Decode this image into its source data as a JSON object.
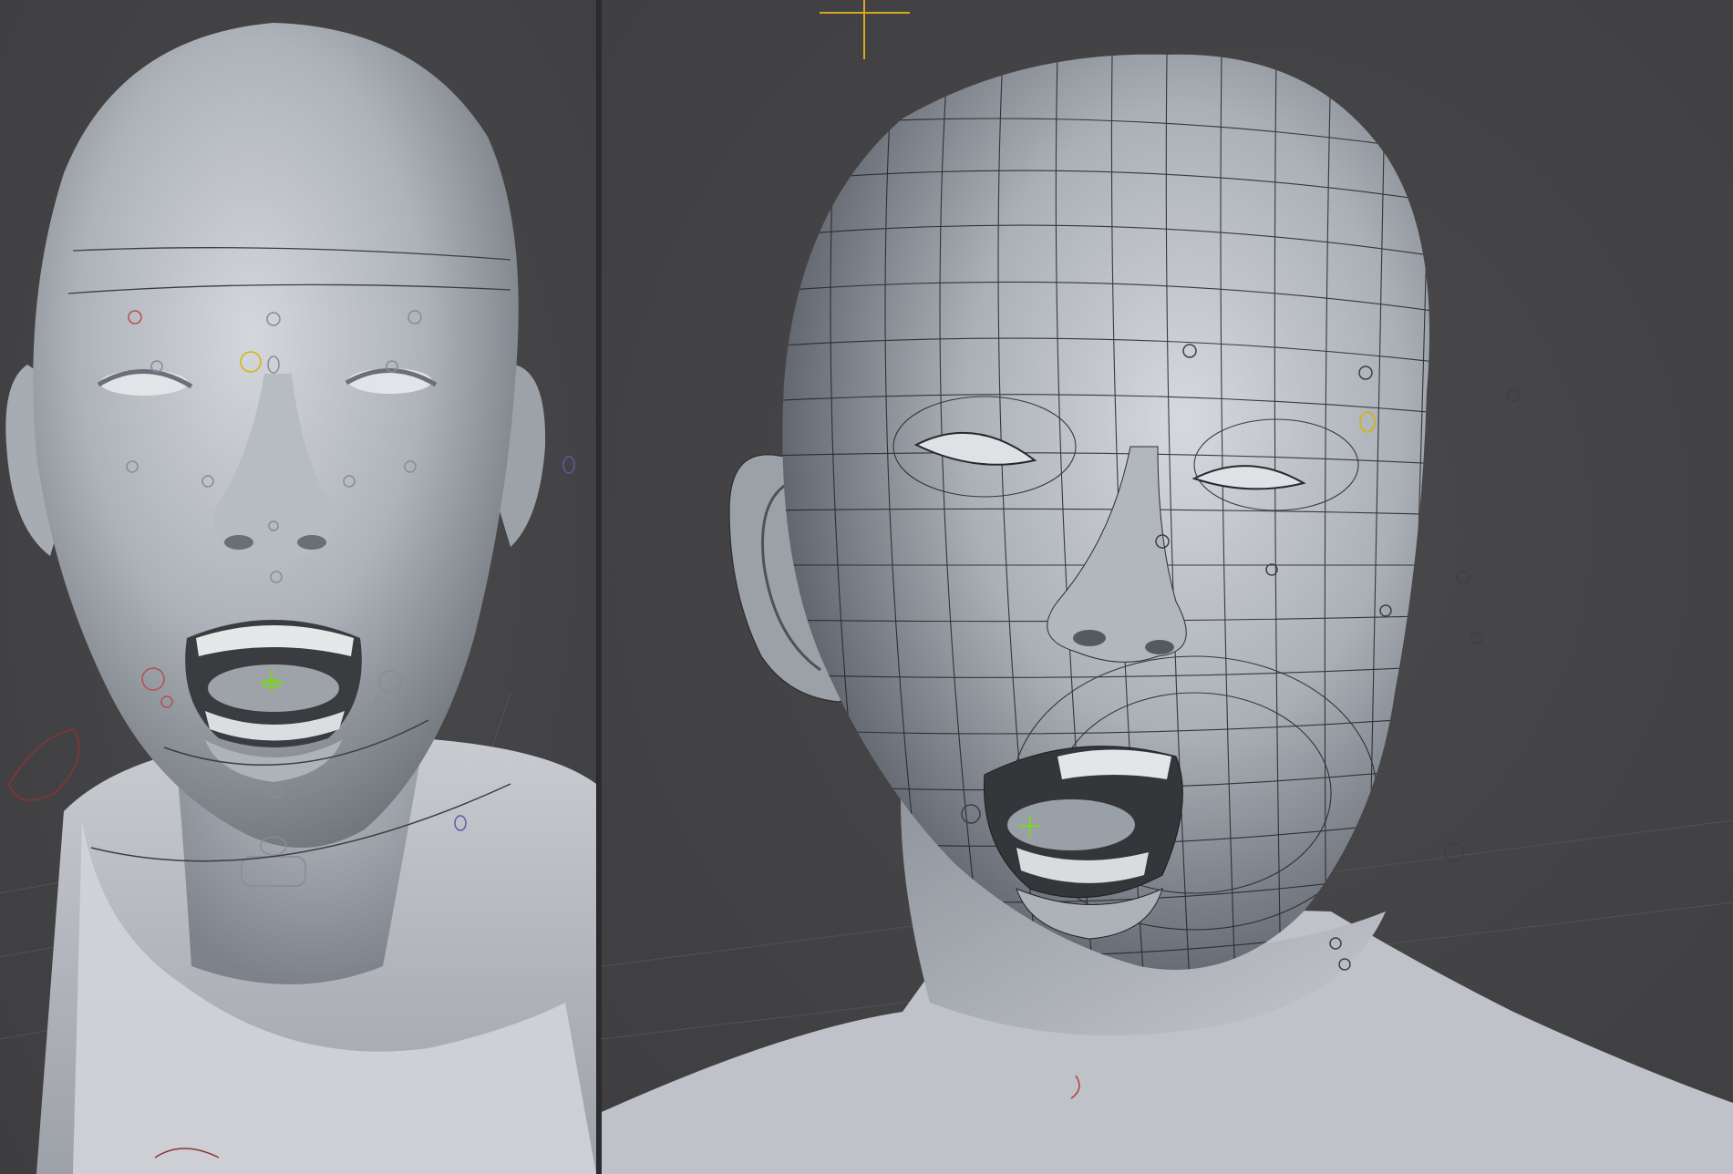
{
  "viewports": [
    {
      "id": "left",
      "shading": "smooth-shaded",
      "wireframe": false,
      "expression": "open-mouth"
    },
    {
      "id": "right",
      "shading": "smooth-shaded",
      "wireframe": true,
      "expression": "open-mouth"
    }
  ],
  "colors": {
    "background": "#444446",
    "divider": "#2c2c2e",
    "skin_light": "#c9ccd1",
    "skin_mid": "#9ea3aa",
    "skin_dark": "#5f646b",
    "wire": "#1f2226",
    "control_gray": "#8a8a95",
    "control_yellow": "#d4b400",
    "control_red": "#b53a3a",
    "control_green": "#7ed321",
    "control_blue": "#5a5aa8",
    "pivot_gold": "#d9a620"
  },
  "icons": {
    "pivot": "crosshair-icon",
    "controls": "circle-control-icon"
  }
}
